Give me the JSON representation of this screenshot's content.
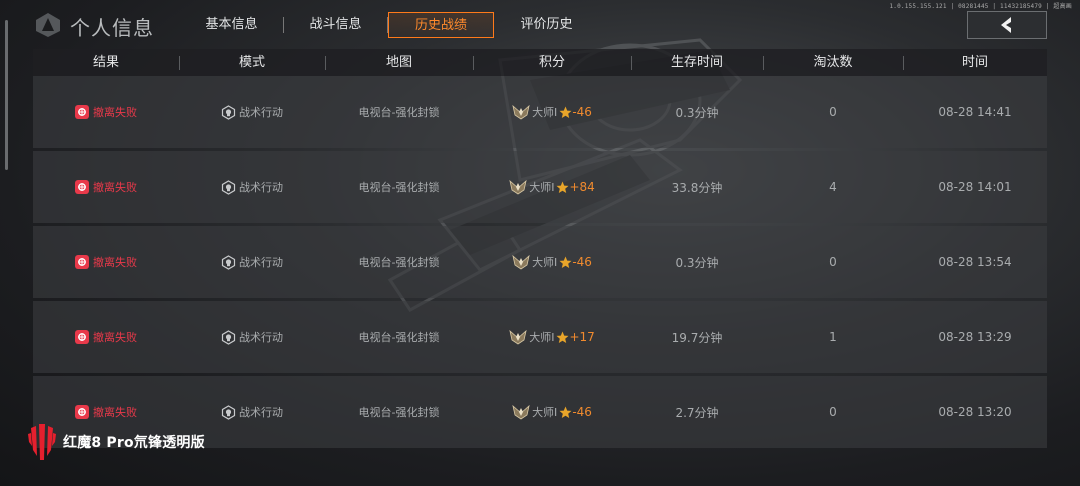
{
  "status_meta": "1.0.155.155.121 | 08281445 | 11432185479 | 超高画",
  "header": {
    "title": "个人信息",
    "tabs": [
      {
        "label": "基本信息",
        "active": false
      },
      {
        "label": "战斗信息",
        "active": false
      },
      {
        "label": "历史战绩",
        "active": true
      },
      {
        "label": "评价历史",
        "active": false
      }
    ]
  },
  "table": {
    "columns": [
      "结果",
      "模式",
      "地图",
      "积分",
      "生存时间",
      "淘汰数",
      "时间"
    ],
    "rows": [
      {
        "result": "撤离失败",
        "mode": "战术行动",
        "map": "电视台-强化封锁",
        "rank": "大师I",
        "score": "-46",
        "survival": "0.3分钟",
        "kills": "0",
        "time": "08-28 14:41"
      },
      {
        "result": "撤离失败",
        "mode": "战术行动",
        "map": "电视台-强化封锁",
        "rank": "大师I",
        "score": "+84",
        "survival": "33.8分钟",
        "kills": "4",
        "time": "08-28 14:01"
      },
      {
        "result": "撤离失败",
        "mode": "战术行动",
        "map": "电视台-强化封锁",
        "rank": "大师I",
        "score": "-46",
        "survival": "0.3分钟",
        "kills": "0",
        "time": "08-28 13:54"
      },
      {
        "result": "撤离失败",
        "mode": "战术行动",
        "map": "电视台-强化封锁",
        "rank": "大师I",
        "score": "+17",
        "survival": "19.7分钟",
        "kills": "1",
        "time": "08-28 13:29"
      },
      {
        "result": "撤离失败",
        "mode": "战术行动",
        "map": "电视台-强化封锁",
        "rank": "大师I",
        "score": "-46",
        "survival": "2.7分钟",
        "kills": "0",
        "time": "08-28 13:20"
      }
    ]
  },
  "watermark": {
    "text": "红魔8 Pro氘锋透明版"
  },
  "colors": {
    "accent": "#ff7a1a",
    "fail": "#e8394a",
    "score": "#f08a2e"
  },
  "icons": {
    "header_logo": "game-logo-icon",
    "back": "chevron-left-icon",
    "result": "extraction-fail-icon",
    "mode": "skull-emblem-icon",
    "rank": "master-rank-badge-icon",
    "star": "star-icon",
    "brand": "redmagic-logo-icon"
  }
}
